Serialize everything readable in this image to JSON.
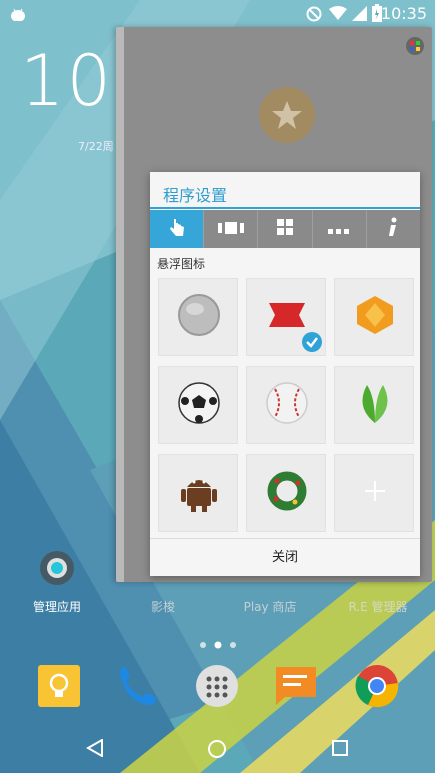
{
  "status_bar": {
    "time": "10:35",
    "icons": [
      "android-icon",
      "no-disturb-icon",
      "wifi-icon",
      "signal-icon",
      "battery-icon"
    ]
  },
  "lockclock": {
    "time": "10:",
    "date": "7/22周"
  },
  "dialog": {
    "title": "程序设置",
    "tabs": [
      {
        "name": "touch",
        "icon": "hand-pointer-icon"
      },
      {
        "name": "film",
        "icon": "film-strip-icon"
      },
      {
        "name": "grid",
        "icon": "grid-icon"
      },
      {
        "name": "more",
        "icon": "more-dots-icon"
      },
      {
        "name": "info",
        "icon": "info-icon"
      }
    ],
    "section_label": "悬浮图标",
    "icons": [
      "gray-circle",
      "red-ribbon",
      "orange-gem",
      "soccer-ball",
      "baseball",
      "green-leaf",
      "android-robot",
      "christmas-wreath",
      "add"
    ],
    "selected_index": 1,
    "close_label": "关闭"
  },
  "home": {
    "app_labels": [
      "管理应用",
      "影梭",
      "Play 商店",
      "R.E 管理器"
    ],
    "dock": [
      "keep-icon",
      "phone-icon",
      "apps-drawer-icon",
      "messages-icon",
      "chrome-icon"
    ],
    "page_indicator_count": 3
  },
  "nav": [
    "back-icon",
    "home-icon",
    "recents-icon"
  ],
  "colors": {
    "accent": "#2fa3d6",
    "tab_bar": "#8a8a8a",
    "dialog_bg": "#f5f5f5"
  }
}
